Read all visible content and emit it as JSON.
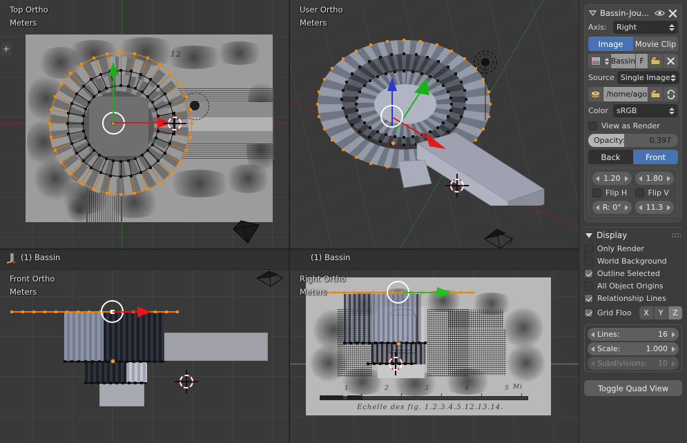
{
  "app": "blender-quad-view",
  "viewports": [
    {
      "id": "top",
      "view_name": "Top Ortho",
      "units": "Meters",
      "object_label": "",
      "background_image": "plan-drawing"
    },
    {
      "id": "user",
      "view_name": "User Ortho",
      "units": "Meters",
      "object_label": "(1) Bassin",
      "background_image": ""
    },
    {
      "id": "front",
      "view_name": "Front Ortho",
      "units": "Meters",
      "object_label": "(1) Bassin",
      "background_image": ""
    },
    {
      "id": "right",
      "view_name": "Right Ortho",
      "units": "Meters",
      "object_label": "",
      "background_image": "elevation-drawing"
    }
  ],
  "reference_drawing": {
    "plan_annotation": "12",
    "elevation_caption": "Echelle des  fig.  1.2.3.4.5.12.13.14.",
    "elevation_scale_ticks": [
      "1",
      "2",
      "3",
      "4",
      "5"
    ],
    "elevation_scale_unit": "Mi"
  },
  "panel": {
    "background_image_block": {
      "title": "Bassin-Jou...",
      "visible_icon": "eye-icon",
      "remove_icon": "close-icon",
      "axis": {
        "label": "Axis:",
        "value": "Right"
      },
      "source_type_tabs": [
        {
          "label": "Image",
          "active": true
        },
        {
          "label": "Movie Clip",
          "active": false
        }
      ],
      "datablock": {
        "icon": "image-datablock-icon",
        "name": "Bassin",
        "fake_user_label": "F",
        "open_icon": "folder-icon",
        "unlink_icon": "close-icon"
      },
      "source": {
        "label": "Source",
        "value": "Single Image"
      },
      "filepath": {
        "icon": "image-file-icon",
        "value": "/home/ago...",
        "browse_icon": "folder-icon",
        "reload_icon": "refresh-icon"
      },
      "color": {
        "label": "Color",
        "value": "sRGB"
      },
      "view_as_render": {
        "label": "View as Render",
        "checked": false
      },
      "opacity": {
        "label": "Opacity:",
        "value": "0.397",
        "fill_percent": 39.7
      },
      "depth_tabs": [
        {
          "label": "Back",
          "active": false
        },
        {
          "label": "Front",
          "active": true
        }
      ],
      "offset_x": "1.20",
      "offset_y": "1.80",
      "flip_h": {
        "label": "Flip H",
        "checked": false
      },
      "flip_v": {
        "label": "Flip V",
        "checked": false
      },
      "rotation": "R: 0°",
      "size": "11.3"
    },
    "display": {
      "title": "Display",
      "grip_icon": "grip-dots-icon",
      "checkboxes": [
        {
          "label": "Only Render",
          "checked": false
        },
        {
          "label": "World Background",
          "checked": false
        },
        {
          "label": "Outline Selected",
          "checked": true
        },
        {
          "label": "All Object Origins",
          "checked": false
        },
        {
          "label": "Relationship Lines",
          "checked": true
        }
      ],
      "grid_floor": {
        "label": "Grid Floo",
        "checked": true
      },
      "axes": [
        {
          "label": "X",
          "active": false
        },
        {
          "label": "Y",
          "active": false
        },
        {
          "label": "Z",
          "active": true
        }
      ],
      "lines": {
        "label": "Lines:",
        "value": "16"
      },
      "scale": {
        "label": "Scale:",
        "value": "1.000"
      },
      "subdivisions": {
        "label": "Subdivisions:",
        "value": "10",
        "disabled": true
      },
      "toggle_quad_view": "Toggle Quad View"
    }
  },
  "colors": {
    "accent_blue": "#4772b3",
    "selection_orange": "#e8820c",
    "axis_x_red": "#7a2b2b",
    "axis_y_green": "#2d6b2d",
    "axis_z_blue": "#2b3e78",
    "panel_bg": "#3c3c3c",
    "viewport_bg": "#393939"
  }
}
